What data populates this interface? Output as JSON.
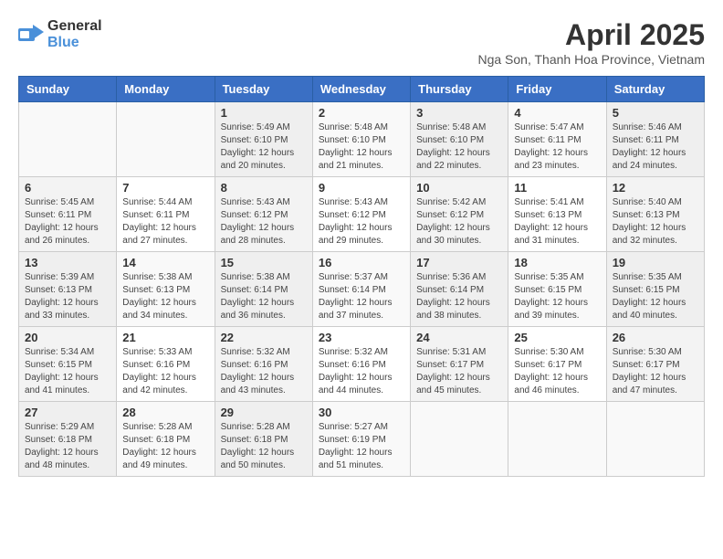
{
  "header": {
    "logo_general": "General",
    "logo_blue": "Blue",
    "month_title": "April 2025",
    "location": "Nga Son, Thanh Hoa Province, Vietnam"
  },
  "days_of_week": [
    "Sunday",
    "Monday",
    "Tuesday",
    "Wednesday",
    "Thursday",
    "Friday",
    "Saturday"
  ],
  "weeks": [
    [
      {
        "day": "",
        "info": ""
      },
      {
        "day": "",
        "info": ""
      },
      {
        "day": "1",
        "info": "Sunrise: 5:49 AM\nSunset: 6:10 PM\nDaylight: 12 hours and 20 minutes."
      },
      {
        "day": "2",
        "info": "Sunrise: 5:48 AM\nSunset: 6:10 PM\nDaylight: 12 hours and 21 minutes."
      },
      {
        "day": "3",
        "info": "Sunrise: 5:48 AM\nSunset: 6:10 PM\nDaylight: 12 hours and 22 minutes."
      },
      {
        "day": "4",
        "info": "Sunrise: 5:47 AM\nSunset: 6:11 PM\nDaylight: 12 hours and 23 minutes."
      },
      {
        "day": "5",
        "info": "Sunrise: 5:46 AM\nSunset: 6:11 PM\nDaylight: 12 hours and 24 minutes."
      }
    ],
    [
      {
        "day": "6",
        "info": "Sunrise: 5:45 AM\nSunset: 6:11 PM\nDaylight: 12 hours and 26 minutes."
      },
      {
        "day": "7",
        "info": "Sunrise: 5:44 AM\nSunset: 6:11 PM\nDaylight: 12 hours and 27 minutes."
      },
      {
        "day": "8",
        "info": "Sunrise: 5:43 AM\nSunset: 6:12 PM\nDaylight: 12 hours and 28 minutes."
      },
      {
        "day": "9",
        "info": "Sunrise: 5:43 AM\nSunset: 6:12 PM\nDaylight: 12 hours and 29 minutes."
      },
      {
        "day": "10",
        "info": "Sunrise: 5:42 AM\nSunset: 6:12 PM\nDaylight: 12 hours and 30 minutes."
      },
      {
        "day": "11",
        "info": "Sunrise: 5:41 AM\nSunset: 6:13 PM\nDaylight: 12 hours and 31 minutes."
      },
      {
        "day": "12",
        "info": "Sunrise: 5:40 AM\nSunset: 6:13 PM\nDaylight: 12 hours and 32 minutes."
      }
    ],
    [
      {
        "day": "13",
        "info": "Sunrise: 5:39 AM\nSunset: 6:13 PM\nDaylight: 12 hours and 33 minutes."
      },
      {
        "day": "14",
        "info": "Sunrise: 5:38 AM\nSunset: 6:13 PM\nDaylight: 12 hours and 34 minutes."
      },
      {
        "day": "15",
        "info": "Sunrise: 5:38 AM\nSunset: 6:14 PM\nDaylight: 12 hours and 36 minutes."
      },
      {
        "day": "16",
        "info": "Sunrise: 5:37 AM\nSunset: 6:14 PM\nDaylight: 12 hours and 37 minutes."
      },
      {
        "day": "17",
        "info": "Sunrise: 5:36 AM\nSunset: 6:14 PM\nDaylight: 12 hours and 38 minutes."
      },
      {
        "day": "18",
        "info": "Sunrise: 5:35 AM\nSunset: 6:15 PM\nDaylight: 12 hours and 39 minutes."
      },
      {
        "day": "19",
        "info": "Sunrise: 5:35 AM\nSunset: 6:15 PM\nDaylight: 12 hours and 40 minutes."
      }
    ],
    [
      {
        "day": "20",
        "info": "Sunrise: 5:34 AM\nSunset: 6:15 PM\nDaylight: 12 hours and 41 minutes."
      },
      {
        "day": "21",
        "info": "Sunrise: 5:33 AM\nSunset: 6:16 PM\nDaylight: 12 hours and 42 minutes."
      },
      {
        "day": "22",
        "info": "Sunrise: 5:32 AM\nSunset: 6:16 PM\nDaylight: 12 hours and 43 minutes."
      },
      {
        "day": "23",
        "info": "Sunrise: 5:32 AM\nSunset: 6:16 PM\nDaylight: 12 hours and 44 minutes."
      },
      {
        "day": "24",
        "info": "Sunrise: 5:31 AM\nSunset: 6:17 PM\nDaylight: 12 hours and 45 minutes."
      },
      {
        "day": "25",
        "info": "Sunrise: 5:30 AM\nSunset: 6:17 PM\nDaylight: 12 hours and 46 minutes."
      },
      {
        "day": "26",
        "info": "Sunrise: 5:30 AM\nSunset: 6:17 PM\nDaylight: 12 hours and 47 minutes."
      }
    ],
    [
      {
        "day": "27",
        "info": "Sunrise: 5:29 AM\nSunset: 6:18 PM\nDaylight: 12 hours and 48 minutes."
      },
      {
        "day": "28",
        "info": "Sunrise: 5:28 AM\nSunset: 6:18 PM\nDaylight: 12 hours and 49 minutes."
      },
      {
        "day": "29",
        "info": "Sunrise: 5:28 AM\nSunset: 6:18 PM\nDaylight: 12 hours and 50 minutes."
      },
      {
        "day": "30",
        "info": "Sunrise: 5:27 AM\nSunset: 6:19 PM\nDaylight: 12 hours and 51 minutes."
      },
      {
        "day": "",
        "info": ""
      },
      {
        "day": "",
        "info": ""
      },
      {
        "day": "",
        "info": ""
      }
    ]
  ]
}
